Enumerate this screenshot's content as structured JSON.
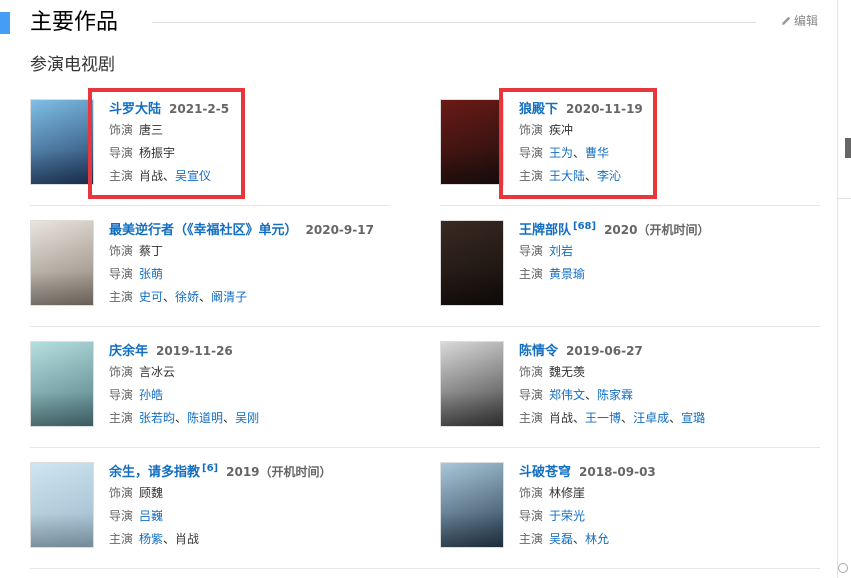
{
  "header": {
    "title": "主要作品",
    "edit_label": "编辑"
  },
  "section": {
    "title": "参演电视剧"
  },
  "labels": {
    "role": "饰演",
    "director": "导演",
    "starring": "主演"
  },
  "works": [
    {
      "title": "斗罗大陆",
      "date": "2021-2-5",
      "sup": "",
      "role": "唐三",
      "director": [],
      "director_text": "杨振宇",
      "starring": [
        {
          "t": "肖战",
          "link": false
        },
        {
          "t": "吴宣仪",
          "link": true
        }
      ],
      "poster_colors": [
        "#7fbfe6",
        "#203a63"
      ]
    },
    {
      "title": "狼殿下",
      "date": "2020-11-19",
      "sup": "",
      "role": "疾冲",
      "director": [
        {
          "t": "王为",
          "link": true
        },
        {
          "t": "曹华",
          "link": true
        }
      ],
      "director_text": "",
      "starring": [
        {
          "t": "王大陆",
          "link": true
        },
        {
          "t": "李沁",
          "link": true
        }
      ],
      "poster_colors": [
        "#6b1a16",
        "#1b0f0e"
      ]
    },
    {
      "title": "最美逆行者（《幸福社区》单元）",
      "date": "2020-9-17",
      "sup": "",
      "role": "蔡丁",
      "director": [
        {
          "t": "张萌",
          "link": true
        }
      ],
      "director_text": "",
      "starring": [
        {
          "t": "史可",
          "link": true
        },
        {
          "t": "徐娇",
          "link": true
        },
        {
          "t": "阚清子",
          "link": true
        }
      ],
      "poster_colors": [
        "#e9e4dd",
        "#8a7f73"
      ]
    },
    {
      "title": "王牌部队",
      "date": "2020（开机时间）",
      "sup": "[68]",
      "role": "",
      "director": [
        {
          "t": "刘岩",
          "link": true
        }
      ],
      "director_text": "",
      "starring": [
        {
          "t": "黄景瑜",
          "link": true
        }
      ],
      "poster_colors": [
        "#3a2a22",
        "#120d0b"
      ]
    },
    {
      "title": "庆余年",
      "date": "2019-11-26",
      "sup": "",
      "role": "言冰云",
      "director": [
        {
          "t": "孙皓",
          "link": true
        }
      ],
      "director_text": "",
      "starring": [
        {
          "t": "张若昀",
          "link": true
        },
        {
          "t": "陈道明",
          "link": true
        },
        {
          "t": "吴刚",
          "link": true
        }
      ],
      "poster_colors": [
        "#b6dfe0",
        "#4f7a80"
      ]
    },
    {
      "title": "陈情令",
      "date": "2019-06-27",
      "sup": "",
      "role": "魏无羡",
      "director": [
        {
          "t": "郑伟文",
          "link": true
        },
        {
          "t": "陈家霖",
          "link": true
        }
      ],
      "director_text": "",
      "starring": [
        {
          "t": "肖战",
          "link": false
        },
        {
          "t": "王一博",
          "link": true
        },
        {
          "t": "汪卓成",
          "link": true
        },
        {
          "t": "宣璐",
          "link": true
        }
      ],
      "poster_colors": [
        "#d9d9d9",
        "#3c3c3c"
      ]
    },
    {
      "title": "余生，请多指教",
      "date": "2019（开机时间）",
      "sup": "[6]",
      "role": "顾魏",
      "director": [
        {
          "t": "吕巍",
          "link": true
        }
      ],
      "director_text": "",
      "starring": [
        {
          "t": "杨紫",
          "link": true
        },
        {
          "t": "肖战",
          "link": false
        }
      ],
      "poster_colors": [
        "#cfe6f2",
        "#9ab7c9"
      ]
    },
    {
      "title": "斗破苍穹",
      "date": "2018-09-03",
      "sup": "",
      "role": "林修崖",
      "director": [
        {
          "t": "于荣光",
          "link": true
        }
      ],
      "director_text": "",
      "starring": [
        {
          "t": "吴磊",
          "link": true
        },
        {
          "t": "林允",
          "link": true
        }
      ],
      "poster_colors": [
        "#a9c7d9",
        "#263a4f"
      ]
    }
  ]
}
